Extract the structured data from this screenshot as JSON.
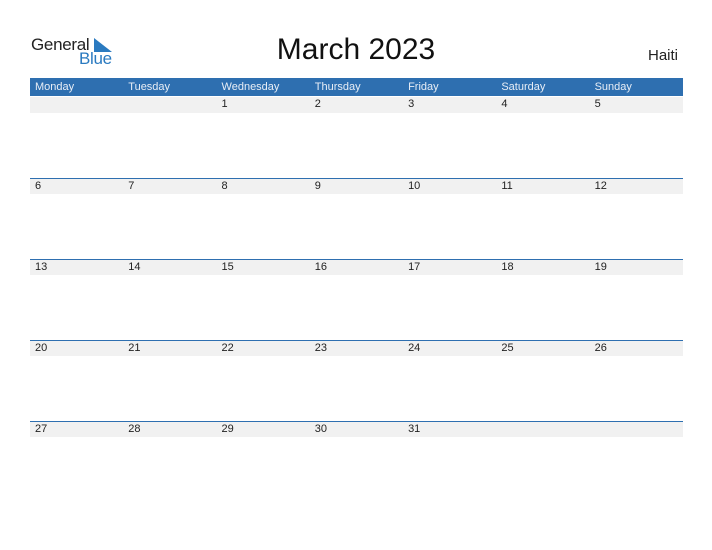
{
  "logo": {
    "text_top": "General",
    "text_bottom": "Blue",
    "brand_color": "#2a7ac0",
    "icon": "triangle-flag-icon"
  },
  "title": "March 2023",
  "country": "Haiti",
  "header_color": "#2e6fb0",
  "weekdays": [
    "Monday",
    "Tuesday",
    "Wednesday",
    "Thursday",
    "Friday",
    "Saturday",
    "Sunday"
  ],
  "weeks": [
    [
      "",
      "",
      "1",
      "2",
      "3",
      "4",
      "5"
    ],
    [
      "6",
      "7",
      "8",
      "9",
      "10",
      "11",
      "12"
    ],
    [
      "13",
      "14",
      "15",
      "16",
      "17",
      "18",
      "19"
    ],
    [
      "20",
      "21",
      "22",
      "23",
      "24",
      "25",
      "26"
    ],
    [
      "27",
      "28",
      "29",
      "30",
      "31",
      "",
      ""
    ]
  ]
}
